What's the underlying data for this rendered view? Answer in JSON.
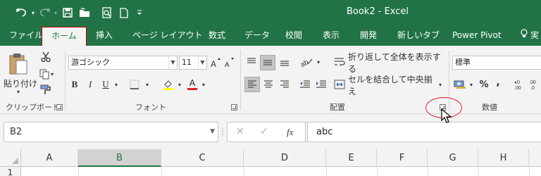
{
  "window": {
    "title": "Book2 - Excel"
  },
  "qat": {
    "undo_icon": "undo-icon",
    "redo_icon": "redo-icon",
    "save_icon": "save-icon",
    "open_icon": "open-folder-icon",
    "print_preview_icon": "print-preview-icon",
    "new_icon": "new-document-icon",
    "customize_icon": "customize-qat-icon"
  },
  "tabs": [
    {
      "label": "ファイル"
    },
    {
      "label": "ホーム"
    },
    {
      "label": "挿入"
    },
    {
      "label": "ページ レイアウト"
    },
    {
      "label": "数式"
    },
    {
      "label": "データ"
    },
    {
      "label": "校閲"
    },
    {
      "label": "表示"
    },
    {
      "label": "開発"
    },
    {
      "label": "新しいタブ"
    },
    {
      "label": "Power Pivot"
    },
    {
      "label": "実"
    }
  ],
  "ribbon": {
    "clipboard": {
      "paste_label": "貼り付け",
      "group_label": "クリップボード"
    },
    "font": {
      "font_name": "游ゴシック",
      "font_size": "11",
      "bold": "B",
      "italic": "I",
      "underline": "U",
      "font_color_letter": "A",
      "group_label": "フォント"
    },
    "alignment": {
      "wrap_text": "折り返して全体を表示する",
      "merge_center": "セルを結合して中央揃え",
      "group_label": "配置"
    },
    "number": {
      "format": "標準",
      "percent": "%",
      "comma": ",",
      "dec_increase": "←.0",
      "dec_decrease": ".00",
      "group_label": "数値"
    }
  },
  "formula_bar": {
    "name_box": "B2",
    "cancel": "✕",
    "enter": "✓",
    "fx": "fx",
    "content": "abc"
  },
  "grid": {
    "columns": [
      "A",
      "B",
      "C",
      "D",
      "E",
      "F",
      "G",
      "H"
    ],
    "selected_column": "B",
    "rows": [
      "1"
    ]
  },
  "colors": {
    "accent": "#217346",
    "annotation": "#e02020"
  }
}
